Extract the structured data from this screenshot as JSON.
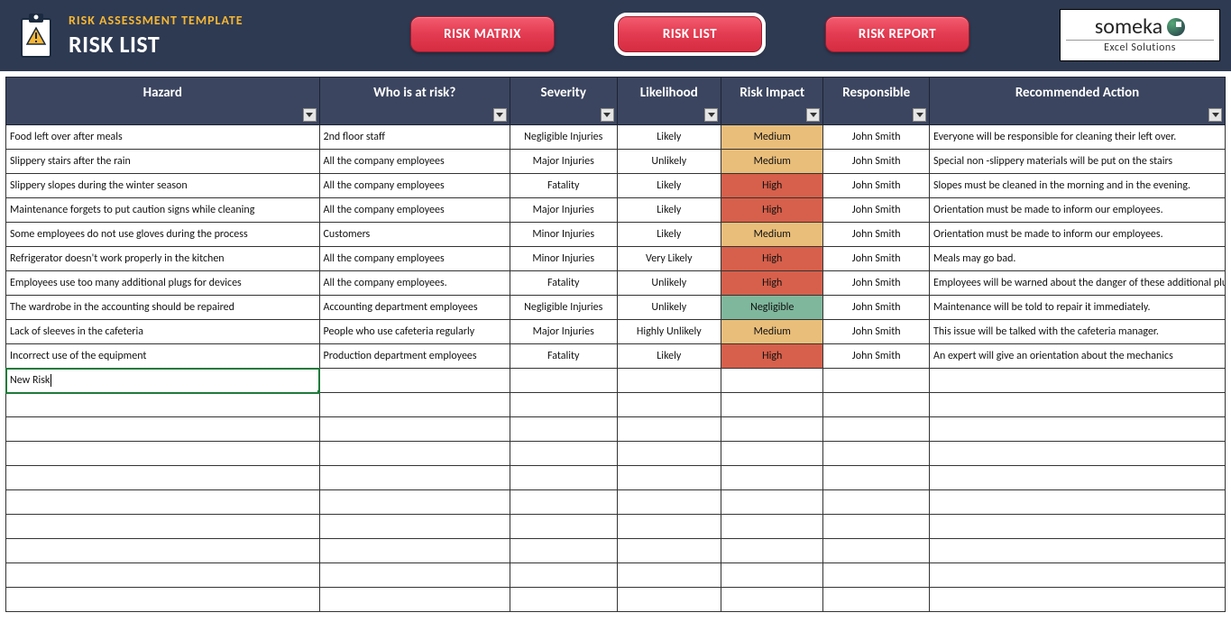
{
  "header": {
    "template_line": "RISK ASSESSMENT TEMPLATE",
    "page_title": "RISK LIST",
    "nav": [
      {
        "label": "RISK MATRIX",
        "active": false
      },
      {
        "label": "RISK LIST",
        "active": true
      },
      {
        "label": "RISK REPORT",
        "active": false
      }
    ],
    "brand_main": "someka",
    "brand_sub": "Excel Solutions"
  },
  "columns": [
    {
      "key": "hazard",
      "label": "Hazard",
      "cls": "col-hazard",
      "align": "left"
    },
    {
      "key": "who",
      "label": "Who is at risk?",
      "cls": "col-who",
      "align": "left"
    },
    {
      "key": "severity",
      "label": "Severity",
      "cls": "col-severity",
      "align": "center"
    },
    {
      "key": "likelihood",
      "label": "Likelihood",
      "cls": "col-likelihood",
      "align": "center"
    },
    {
      "key": "impact",
      "label": "Risk Impact",
      "cls": "col-impact",
      "align": "center"
    },
    {
      "key": "responsible",
      "label": "Responsible",
      "cls": "col-resp",
      "align": "center"
    },
    {
      "key": "action",
      "label": "Recommended Action",
      "cls": "col-action",
      "align": "left"
    }
  ],
  "rows": [
    {
      "hazard": "Food left over after meals",
      "who": "2nd floor staff",
      "severity": "Negligible Injuries",
      "likelihood": "Likely",
      "impact": "Medium",
      "responsible": "John Smith",
      "action": "Everyone will be responsible for cleaning their left over."
    },
    {
      "hazard": "Slippery stairs after the rain",
      "who": "All the company employees",
      "severity": "Major Injuries",
      "likelihood": "Unlikely",
      "impact": "Medium",
      "responsible": "John Smith",
      "action": "Special non -slippery materials will be put on the stairs"
    },
    {
      "hazard": "Slippery slopes during the winter season",
      "who": "All the company employees",
      "severity": "Fatality",
      "likelihood": "Likely",
      "impact": "High",
      "responsible": "John Smith",
      "action": "Slopes must be cleaned in the morning and in the evening."
    },
    {
      "hazard": "Maintenance forgets to put caution signs while cleaning",
      "who": "All the company employees",
      "severity": "Major Injuries",
      "likelihood": "Likely",
      "impact": "High",
      "responsible": "John Smith",
      "action": "Orientation must be made to inform our employees."
    },
    {
      "hazard": "Some employees do not use gloves during the process",
      "who": "Customers",
      "severity": "Minor Injuries",
      "likelihood": "Likely",
      "impact": "Medium",
      "responsible": "John Smith",
      "action": "Orientation must be made to inform our employees."
    },
    {
      "hazard": "Refrigerator doesn't work properly in the kitchen",
      "who": "All the company employees",
      "severity": "Minor Injuries",
      "likelihood": "Very Likely",
      "impact": "High",
      "responsible": "John Smith",
      "action": "Meals may go bad."
    },
    {
      "hazard": "Employees use too many additional plugs for  devices",
      "who": "All the company employees.",
      "severity": "Fatality",
      "likelihood": "Unlikely",
      "impact": "High",
      "responsible": "John Smith",
      "action": "Employees will be warned about the danger of these additional plugs.",
      "action_small": true
    },
    {
      "hazard": "The wardrobe in the accounting should be repaired",
      "who": "Accounting department employees",
      "severity": "Negligible Injuries",
      "likelihood": "Unlikely",
      "impact": "Negligible",
      "responsible": "John Smith",
      "action": "Maintenance will be told to repair it immediately."
    },
    {
      "hazard": "Lack of sleeves in the cafeteria",
      "who": "People who use cafeteria regularly",
      "severity": "Major Injuries",
      "likelihood": "Highly Unlikely",
      "impact": "Medium",
      "responsible": "John Smith",
      "action": "This issue will be talked with the cafeteria manager."
    },
    {
      "hazard": "Incorrect use of the equipment",
      "who": "Production department employees",
      "severity": "Fatality",
      "likelihood": "Likely",
      "impact": "High",
      "responsible": "John Smith",
      "action": "An expert will give an orientation about the mechanics"
    }
  ],
  "editing_cell_value": "New Risk",
  "empty_rows": 9
}
